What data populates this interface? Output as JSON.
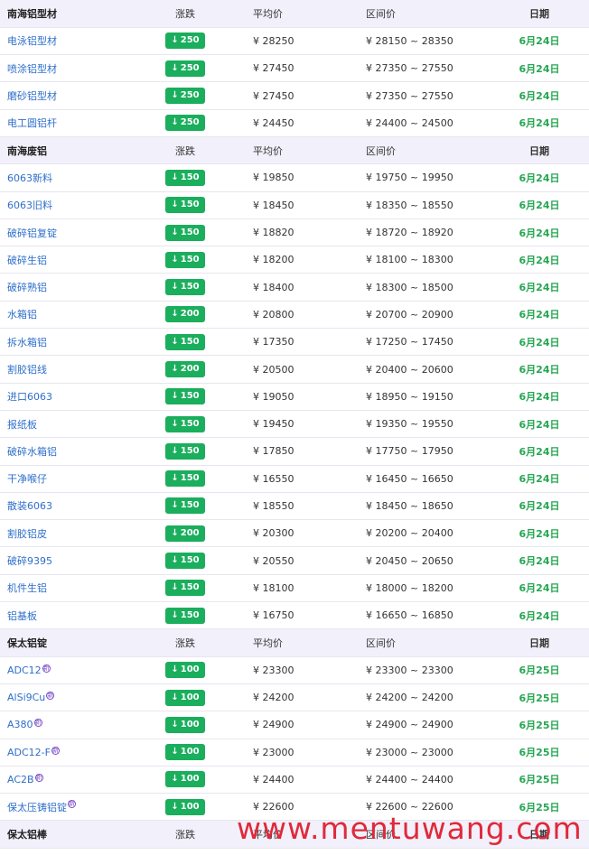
{
  "header": {
    "change": "涨跌",
    "avg": "平均价",
    "range": "区间价",
    "date": "日期"
  },
  "sections": [
    {
      "title": "南海铝型材",
      "rows": [
        {
          "name": "电泳铝型材",
          "change": "250",
          "avg": "¥ 28250",
          "range": "¥ 28150 ~ 28350",
          "date": "6月24日"
        },
        {
          "name": "喷涂铝型材",
          "change": "250",
          "avg": "¥ 27450",
          "range": "¥ 27350 ~ 27550",
          "date": "6月24日"
        },
        {
          "name": "磨砂铝型材",
          "change": "250",
          "avg": "¥ 27450",
          "range": "¥ 27350 ~ 27550",
          "date": "6月24日"
        },
        {
          "name": "电工圆铝杆",
          "change": "250",
          "avg": "¥ 24450",
          "range": "¥ 24400 ~ 24500",
          "date": "6月24日"
        }
      ]
    },
    {
      "title": "南海废铝",
      "rows": [
        {
          "name": "6063新料",
          "change": "150",
          "avg": "¥ 19850",
          "range": "¥ 19750 ~ 19950",
          "date": "6月24日"
        },
        {
          "name": "6063旧料",
          "change": "150",
          "avg": "¥ 18450",
          "range": "¥ 18350 ~ 18550",
          "date": "6月24日"
        },
        {
          "name": "破碎铝复锭",
          "change": "150",
          "avg": "¥ 18820",
          "range": "¥ 18720 ~ 18920",
          "date": "6月24日"
        },
        {
          "name": "破碎生铝",
          "change": "150",
          "avg": "¥ 18200",
          "range": "¥ 18100 ~ 18300",
          "date": "6月24日"
        },
        {
          "name": "破碎熟铝",
          "change": "150",
          "avg": "¥ 18400",
          "range": "¥ 18300 ~ 18500",
          "date": "6月24日"
        },
        {
          "name": "水箱铝",
          "change": "200",
          "avg": "¥ 20800",
          "range": "¥ 20700 ~ 20900",
          "date": "6月24日"
        },
        {
          "name": "拆水箱铝",
          "change": "150",
          "avg": "¥ 17350",
          "range": "¥ 17250 ~ 17450",
          "date": "6月24日"
        },
        {
          "name": "割胶铝线",
          "change": "200",
          "avg": "¥ 20500",
          "range": "¥ 20400 ~ 20600",
          "date": "6月24日"
        },
        {
          "name": "进口6063",
          "change": "150",
          "avg": "¥ 19050",
          "range": "¥ 18950 ~ 19150",
          "date": "6月24日"
        },
        {
          "name": "报纸板",
          "change": "150",
          "avg": "¥ 19450",
          "range": "¥ 19350 ~ 19550",
          "date": "6月24日"
        },
        {
          "name": "破碎水箱铝",
          "change": "150",
          "avg": "¥ 17850",
          "range": "¥ 17750 ~ 17950",
          "date": "6月24日"
        },
        {
          "name": "干净喉仔",
          "change": "150",
          "avg": "¥ 16550",
          "range": "¥ 16450 ~ 16650",
          "date": "6月24日"
        },
        {
          "name": "散装6063",
          "change": "150",
          "avg": "¥ 18550",
          "range": "¥ 18450 ~ 18650",
          "date": "6月24日"
        },
        {
          "name": "割胶铝皮",
          "change": "200",
          "avg": "¥ 20300",
          "range": "¥ 20200 ~ 20400",
          "date": "6月24日"
        },
        {
          "name": "破碎9395",
          "change": "150",
          "avg": "¥ 20550",
          "range": "¥ 20450 ~ 20650",
          "date": "6月24日"
        },
        {
          "name": "机件生铝",
          "change": "150",
          "avg": "¥ 18100",
          "range": "¥ 18000 ~ 18200",
          "date": "6月24日"
        },
        {
          "name": "铝基板",
          "change": "150",
          "avg": "¥ 16750",
          "range": "¥ 16650 ~ 16850",
          "date": "6月24日"
        }
      ]
    },
    {
      "title": "保太铝锭",
      "rows": [
        {
          "name": "ADC12",
          "sup": "新",
          "change": "100",
          "avg": "¥ 23300",
          "range": "¥ 23300 ~ 23300",
          "date": "6月25日"
        },
        {
          "name": "AlSi9Cu",
          "sup": "新",
          "change": "100",
          "avg": "¥ 24200",
          "range": "¥ 24200 ~ 24200",
          "date": "6月25日"
        },
        {
          "name": "A380",
          "sup": "新",
          "change": "100",
          "avg": "¥ 24900",
          "range": "¥ 24900 ~ 24900",
          "date": "6月25日"
        },
        {
          "name": "ADC12-F",
          "sup": "新",
          "change": "100",
          "avg": "¥ 23000",
          "range": "¥ 23000 ~ 23000",
          "date": "6月25日"
        },
        {
          "name": "AC2B",
          "sup": "新",
          "change": "100",
          "avg": "¥ 24400",
          "range": "¥ 24400 ~ 24400",
          "date": "6月25日"
        },
        {
          "name": "保太压铸铝锭",
          "sup": "新",
          "change": "100",
          "avg": "¥ 22600",
          "range": "¥ 22600 ~ 22600",
          "date": "6月25日"
        }
      ]
    },
    {
      "title": "保太铝棒",
      "rows": []
    }
  ],
  "arrow_glyph": "↓",
  "watermark": "www.mentuwang.com",
  "colors": {
    "badge": "#1aae5d",
    "date": "#25a652",
    "name": "#2f6fc9",
    "header_bg": "#f2f0fa",
    "watermark": "#e0293a"
  }
}
